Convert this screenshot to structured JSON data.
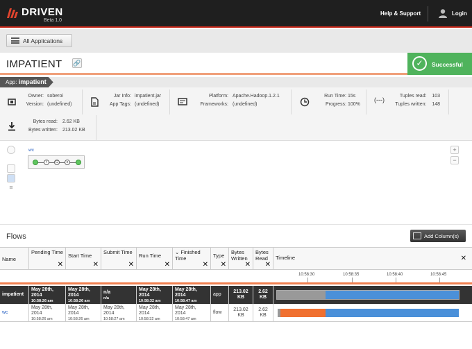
{
  "brand": {
    "name": "DRIVEN",
    "subtitle": "Beta 1.0"
  },
  "topnav": {
    "help": "Help & Support",
    "login": "Login"
  },
  "toolbar": {
    "all_apps": "All Applications"
  },
  "app": {
    "title": "IMPATIENT",
    "status": "Successful",
    "crumb_prefix": "App:",
    "crumb_name": "impatient"
  },
  "info": {
    "owner_label": "Owner:",
    "owner": "soberoi",
    "version_label": "Version:",
    "version": "(undefined)",
    "jar_label": "Jar Info:",
    "jar": "impatient.jar",
    "tags_label": "App Tags:",
    "tags": "(undefined)",
    "platform_label": "Platform:",
    "platform": "Apache.Hadoop.1.2.1",
    "frameworks_label": "Frameworks:",
    "frameworks": "(undefined)",
    "runtime_label": "Run Time:",
    "runtime": "15s",
    "progress_label": "Progress:",
    "progress": "100%",
    "tuples_read_label": "Tuples read:",
    "tuples_read": "103",
    "tuples_written_label": "Tuples written:",
    "tuples_written": "148",
    "bytes_read_label": "Bytes read:",
    "bytes_read": "2.62 KB",
    "bytes_written_label": "Bytes written:",
    "bytes_written": "213.02 KB"
  },
  "diagram": {
    "flow_label": "wc",
    "nodes": [
      "f",
      "G",
      "e"
    ],
    "zoom_in": "+",
    "zoom_out": "−"
  },
  "flows": {
    "title": "Flows",
    "add_column": "Add Column(s)",
    "columns": [
      "Name",
      "Pending Time",
      "Start Time",
      "Submit Time",
      "Run Time",
      "Finished Time",
      "Type",
      "Bytes Written",
      "Bytes Read",
      "Timeline"
    ],
    "ticks": [
      "10:58:30",
      "10:58:35",
      "10:58:40",
      "10:58:45"
    ],
    "rows": [
      {
        "name": "impatient",
        "pending": "May 28th, 2014",
        "pending_t": "10:58:26 am",
        "start": "May 28th, 2014",
        "start_t": "10:58:26 am",
        "submit": "n/a",
        "submit_t": "n/a",
        "run": "May 28th, 2014",
        "run_t": "10:58:32 am",
        "finished": "May 28th, 2014",
        "finished_t": "10:58:47 am",
        "type": "app",
        "bytes_written": "213.02 KB",
        "bytes_read": "2.62 KB"
      },
      {
        "name": "wc",
        "pending": "May 28th, 2014",
        "pending_t": "10:58:26 am",
        "start": "May 28th, 2014",
        "start_t": "10:58:26 am",
        "submit": "May 28th, 2014",
        "submit_t": "10:58:27 am",
        "run": "May 28th, 2014",
        "run_t": "10:58:32 am",
        "finished": "May 28th, 2014",
        "finished_t": "10:58:47 am",
        "type": "flow",
        "bytes_written": "213.02 KB",
        "bytes_read": "2.62 KB"
      }
    ]
  },
  "colors": {
    "accent": "#c8291b",
    "success": "#4fb35c",
    "timeline_blue": "#4a90d9",
    "timeline_orange": "#f07030",
    "timeline_gray": "#999999"
  }
}
